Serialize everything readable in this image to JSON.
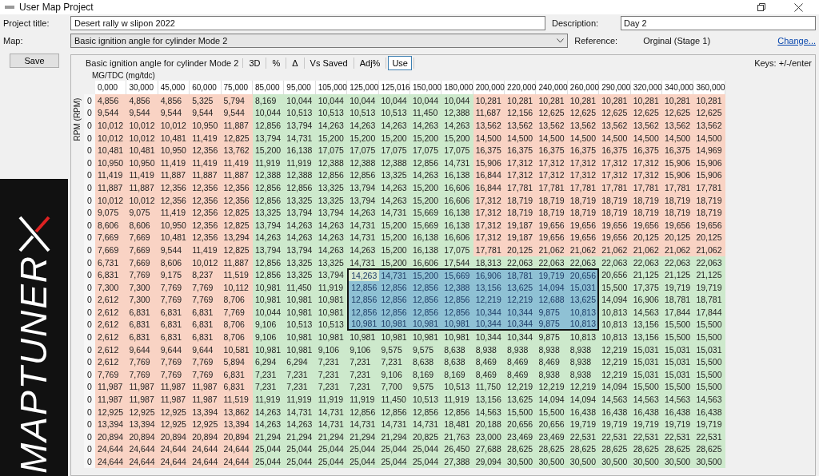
{
  "window": {
    "title": "User Map Project"
  },
  "form": {
    "project_title_label": "Project title:",
    "project_title": "Desert rally w slipon 2022",
    "map_label": "Map:",
    "map": "Basic ignition angle for cylinder Mode 2",
    "description_label": "Description:",
    "description": "Day 2",
    "reference_label": "Reference:",
    "reference": "Orginal (Stage 1)",
    "change_link": "Change..."
  },
  "save_button": "Save",
  "logo": {
    "text": "MAPTUNER"
  },
  "toolbar": {
    "title": "Basic ignition angle for cylinder Mode 2",
    "buttons": [
      {
        "label": "3D",
        "selected": false
      },
      {
        "label": "%",
        "selected": false
      },
      {
        "label": "Δ",
        "selected": false
      },
      {
        "label": "Vs Saved",
        "selected": false
      },
      {
        "label": "Adj%",
        "selected": false
      },
      {
        "label": "Use",
        "selected": true
      }
    ],
    "keys": "Keys: +/-/enter"
  },
  "table": {
    "x_axis_label": "MG/TDC (mg/tdc)",
    "y_axis_label": "RPM (RPM)",
    "columns": [
      {
        "label": "0,000",
        "color": "#f9d3c4",
        "green_below": false,
        "selected": false
      },
      {
        "label": "30,000",
        "color": "#f9d3c4",
        "green_below": false,
        "selected": false
      },
      {
        "label": "45,000",
        "color": "#f9d3c4",
        "green_below": false,
        "selected": false
      },
      {
        "label": "60,000",
        "color": "#f9d3c4",
        "green_below": false,
        "selected": false
      },
      {
        "label": "75,000",
        "color": "#f9d3c4",
        "green_below": false,
        "selected": false
      },
      {
        "label": "85,000",
        "color": "#cde9cc",
        "green_below": false,
        "selected": false
      },
      {
        "label": "95,000",
        "color": "#cde9cc",
        "green_below": false,
        "selected": false
      },
      {
        "label": "105,000",
        "color": "#cde9cc",
        "green_below": false,
        "selected": false
      },
      {
        "label": "125,000",
        "color": "#cde9cc",
        "green_below": false,
        "selected": true
      },
      {
        "label": "125,016",
        "color": "#cde9cc",
        "green_below": false,
        "selected": true
      },
      {
        "label": "150,000",
        "color": "#cde9cc",
        "green_below": false,
        "selected": true
      },
      {
        "label": "180,000",
        "color": "#cde9cc",
        "green_below": false,
        "selected": true
      },
      {
        "label": "200,000",
        "color": "#f9d3c4",
        "green_below": true,
        "selected": true
      },
      {
        "label": "220,000",
        "color": "#f9d3c4",
        "green_below": true,
        "selected": true
      },
      {
        "label": "240,000",
        "color": "#f9d3c4",
        "green_below": true,
        "selected": true
      },
      {
        "label": "260,000",
        "color": "#f9d3c4",
        "green_below": true,
        "selected": true
      },
      {
        "label": "290,000",
        "color": "#f9d3c4",
        "green_below": true,
        "selected": false
      },
      {
        "label": "320,000",
        "color": "#f9d3c4",
        "green_below": true,
        "selected": false
      },
      {
        "label": "340,000",
        "color": "#f9d3c4",
        "green_below": true,
        "selected": false
      },
      {
        "label": "360,000",
        "color": "#f9d3c4",
        "green_below": true,
        "selected": false
      }
    ],
    "rows": [
      {
        "label": "0",
        "lower": false,
        "selected": false,
        "cells": [
          "4,856",
          "4,856",
          "4,856",
          "5,325",
          "5,794",
          "8,169",
          "10,044",
          "10,044",
          "10,044",
          "10,044",
          "10,044",
          "10,044",
          "10,281",
          "10,281",
          "10,281",
          "10,281",
          "10,281",
          "10,281",
          "10,281",
          "10,281"
        ]
      },
      {
        "label": "0",
        "lower": false,
        "selected": false,
        "cells": [
          "9,544",
          "9,544",
          "9,544",
          "9,544",
          "9,544",
          "10,044",
          "10,513",
          "10,513",
          "10,513",
          "10,513",
          "11,450",
          "12,388",
          "11,687",
          "12,156",
          "12,625",
          "12,625",
          "12,625",
          "12,625",
          "12,625",
          "12,625"
        ]
      },
      {
        "label": "0",
        "lower": false,
        "selected": false,
        "cells": [
          "10,012",
          "10,012",
          "10,012",
          "10,950",
          "11,887",
          "12,856",
          "13,794",
          "14,263",
          "14,263",
          "14,263",
          "14,263",
          "14,263",
          "13,562",
          "13,562",
          "13,562",
          "13,562",
          "13,562",
          "13,562",
          "13,562",
          "13,562"
        ]
      },
      {
        "label": "0",
        "lower": false,
        "selected": false,
        "cells": [
          "10,012",
          "10,012",
          "10,481",
          "11,419",
          "12,825",
          "13,794",
          "14,731",
          "15,200",
          "15,200",
          "15,200",
          "15,200",
          "15,200",
          "14,500",
          "14,500",
          "14,500",
          "14,500",
          "14,500",
          "14,500",
          "14,500",
          "14,500"
        ]
      },
      {
        "label": "0",
        "lower": false,
        "selected": false,
        "cells": [
          "10,481",
          "10,481",
          "10,950",
          "12,356",
          "13,762",
          "15,200",
          "16,138",
          "17,075",
          "17,075",
          "17,075",
          "17,075",
          "17,075",
          "16,375",
          "16,375",
          "16,375",
          "16,375",
          "16,375",
          "16,375",
          "16,375",
          "14,969"
        ]
      },
      {
        "label": "0",
        "lower": false,
        "selected": false,
        "cells": [
          "10,950",
          "10,950",
          "11,419",
          "11,419",
          "11,419",
          "11,919",
          "11,919",
          "12,388",
          "12,388",
          "12,388",
          "12,856",
          "14,731",
          "15,906",
          "17,312",
          "17,312",
          "17,312",
          "17,312",
          "17,312",
          "15,906",
          "15,906"
        ]
      },
      {
        "label": "0",
        "lower": false,
        "selected": false,
        "cells": [
          "11,419",
          "11,419",
          "11,887",
          "11,887",
          "11,887",
          "12,388",
          "12,388",
          "12,856",
          "12,856",
          "13,325",
          "14,263",
          "16,138",
          "16,844",
          "17,312",
          "17,312",
          "17,312",
          "17,312",
          "17,312",
          "15,906",
          "15,906"
        ]
      },
      {
        "label": "0",
        "lower": false,
        "selected": false,
        "cells": [
          "11,887",
          "11,887",
          "12,356",
          "12,356",
          "12,356",
          "12,856",
          "12,856",
          "13,325",
          "13,794",
          "14,263",
          "15,200",
          "16,606",
          "16,844",
          "17,781",
          "17,781",
          "17,781",
          "17,781",
          "17,781",
          "17,781",
          "17,781"
        ]
      },
      {
        "label": "0",
        "lower": false,
        "selected": false,
        "cells": [
          "10,012",
          "10,012",
          "12,356",
          "12,356",
          "12,356",
          "12,856",
          "13,325",
          "13,325",
          "13,794",
          "14,263",
          "15,200",
          "16,606",
          "17,312",
          "18,719",
          "18,719",
          "18,719",
          "18,719",
          "18,719",
          "18,719",
          "18,719"
        ]
      },
      {
        "label": "0",
        "lower": false,
        "selected": false,
        "cells": [
          "9,075",
          "9,075",
          "11,419",
          "12,356",
          "12,825",
          "13,325",
          "13,794",
          "13,794",
          "14,263",
          "14,731",
          "15,669",
          "16,138",
          "17,312",
          "18,719",
          "18,719",
          "18,719",
          "18,719",
          "18,719",
          "18,719",
          "18,719"
        ]
      },
      {
        "label": "0",
        "lower": false,
        "selected": false,
        "cells": [
          "8,606",
          "8,606",
          "10,950",
          "12,356",
          "12,825",
          "13,794",
          "14,263",
          "14,263",
          "14,731",
          "15,200",
          "15,669",
          "16,138",
          "17,312",
          "19,187",
          "19,656",
          "19,656",
          "19,656",
          "19,656",
          "19,656",
          "19,656"
        ]
      },
      {
        "label": "0",
        "lower": false,
        "selected": false,
        "cells": [
          "7,669",
          "7,669",
          "10,481",
          "12,356",
          "13,294",
          "14,263",
          "14,263",
          "14,263",
          "14,731",
          "15,200",
          "16,138",
          "16,606",
          "17,312",
          "19,187",
          "19,656",
          "19,656",
          "19,656",
          "20,125",
          "20,125",
          "20,125"
        ]
      },
      {
        "label": "0",
        "lower": false,
        "selected": false,
        "cells": [
          "7,669",
          "7,669",
          "9,544",
          "11,419",
          "12,825",
          "13,794",
          "13,794",
          "14,263",
          "14,263",
          "15,200",
          "16,138",
          "17,075",
          "17,781",
          "20,125",
          "21,062",
          "21,062",
          "21,062",
          "21,062",
          "21,062",
          "21,062"
        ]
      },
      {
        "label": "0",
        "lower": true,
        "selected": false,
        "cells": [
          "6,731",
          "7,669",
          "8,606",
          "10,012",
          "11,887",
          "12,856",
          "13,325",
          "13,325",
          "14,731",
          "15,200",
          "16,606",
          "17,544",
          "18,313",
          "22,063",
          "22,063",
          "22,063",
          "22,063",
          "22,063",
          "22,063",
          "22,063"
        ]
      },
      {
        "label": "0",
        "lower": true,
        "selected": true,
        "cells": [
          "6,831",
          "7,769",
          "9,175",
          "8,237",
          "11,519",
          "12,856",
          "13,325",
          "13,794",
          "14,263",
          "14,731",
          "15,200",
          "15,669",
          "16,906",
          "18,781",
          "19,719",
          "20,656",
          "20,656",
          "21,125",
          "21,125",
          "21,125"
        ]
      },
      {
        "label": "0",
        "lower": true,
        "selected": true,
        "cells": [
          "7,300",
          "7,300",
          "7,769",
          "7,769",
          "10,112",
          "10,981",
          "11,450",
          "11,919",
          "12,856",
          "12,856",
          "12,856",
          "12,388",
          "13,156",
          "13,625",
          "14,094",
          "15,031",
          "15,500",
          "17,375",
          "19,719",
          "19,719"
        ]
      },
      {
        "label": "0",
        "lower": true,
        "selected": true,
        "cells": [
          "2,612",
          "7,300",
          "7,769",
          "7,769",
          "8,706",
          "10,981",
          "10,981",
          "10,981",
          "12,856",
          "12,856",
          "12,856",
          "12,856",
          "12,219",
          "12,219",
          "12,688",
          "13,625",
          "14,094",
          "16,906",
          "18,781",
          "18,781"
        ]
      },
      {
        "label": "0",
        "lower": true,
        "selected": true,
        "cells": [
          "2,612",
          "6,831",
          "6,831",
          "6,831",
          "7,769",
          "10,044",
          "10,981",
          "10,981",
          "12,856",
          "12,856",
          "12,856",
          "12,856",
          "10,344",
          "10,344",
          "9,875",
          "10,813",
          "10,813",
          "14,563",
          "17,844",
          "17,844"
        ]
      },
      {
        "label": "0",
        "lower": true,
        "selected": true,
        "cells": [
          "2,612",
          "6,831",
          "6,831",
          "6,831",
          "8,706",
          "9,106",
          "10,513",
          "10,513",
          "10,981",
          "10,981",
          "10,981",
          "10,981",
          "10,344",
          "10,344",
          "9,875",
          "10,813",
          "10,813",
          "13,156",
          "15,500",
          "15,500"
        ]
      },
      {
        "label": "0",
        "lower": true,
        "selected": false,
        "cells": [
          "2,612",
          "6,831",
          "6,831",
          "6,831",
          "8,706",
          "9,106",
          "10,981",
          "10,981",
          "10,981",
          "10,981",
          "10,981",
          "10,981",
          "10,344",
          "10,344",
          "9,875",
          "10,813",
          "10,813",
          "13,156",
          "15,500",
          "15,500"
        ]
      },
      {
        "label": "0",
        "lower": true,
        "selected": false,
        "cells": [
          "2,612",
          "9,644",
          "9,644",
          "9,644",
          "10,581",
          "10,981",
          "10,981",
          "9,106",
          "9,106",
          "9,575",
          "9,575",
          "8,638",
          "8,938",
          "8,938",
          "8,938",
          "8,938",
          "12,219",
          "15,031",
          "15,031",
          "15,031"
        ]
      },
      {
        "label": "0",
        "lower": true,
        "selected": false,
        "cells": [
          "2,612",
          "7,769",
          "7,769",
          "7,769",
          "5,894",
          "6,294",
          "6,294",
          "7,231",
          "7,231",
          "7,231",
          "8,638",
          "8,638",
          "8,469",
          "8,469",
          "8,469",
          "8,938",
          "12,219",
          "15,031",
          "15,031",
          "15,500"
        ]
      },
      {
        "label": "0",
        "lower": true,
        "selected": false,
        "cells": [
          "7,769",
          "7,769",
          "7,769",
          "7,769",
          "6,831",
          "7,231",
          "7,231",
          "7,231",
          "7,231",
          "9,106",
          "8,169",
          "8,169",
          "8,469",
          "8,469",
          "8,938",
          "8,938",
          "12,219",
          "15,031",
          "15,031",
          "15,500"
        ]
      },
      {
        "label": "0",
        "lower": true,
        "selected": false,
        "cells": [
          "11,987",
          "11,987",
          "11,987",
          "11,987",
          "6,831",
          "7,231",
          "7,231",
          "7,231",
          "7,231",
          "7,700",
          "9,575",
          "10,513",
          "11,750",
          "12,219",
          "12,219",
          "12,219",
          "14,094",
          "15,500",
          "15,500",
          "15,500"
        ]
      },
      {
        "label": "0",
        "lower": true,
        "selected": false,
        "cells": [
          "11,987",
          "11,987",
          "11,987",
          "11,987",
          "11,519",
          "11,919",
          "11,919",
          "11,919",
          "11,919",
          "11,450",
          "10,513",
          "11,919",
          "13,156",
          "13,625",
          "14,094",
          "14,094",
          "14,563",
          "14,563",
          "14,563",
          "14,563"
        ]
      },
      {
        "label": "0",
        "lower": true,
        "selected": false,
        "cells": [
          "12,925",
          "12,925",
          "12,925",
          "13,394",
          "13,862",
          "14,263",
          "14,731",
          "14,731",
          "12,856",
          "12,856",
          "12,856",
          "12,856",
          "14,563",
          "15,500",
          "15,500",
          "16,438",
          "16,438",
          "16,438",
          "16,438",
          "16,438"
        ]
      },
      {
        "label": "0",
        "lower": true,
        "selected": false,
        "cells": [
          "13,394",
          "13,394",
          "12,925",
          "12,925",
          "13,394",
          "14,263",
          "14,263",
          "14,731",
          "14,731",
          "14,731",
          "14,731",
          "18,481",
          "20,188",
          "20,656",
          "20,656",
          "19,719",
          "19,719",
          "19,719",
          "19,719",
          "19,719"
        ]
      },
      {
        "label": "0",
        "lower": true,
        "selected": false,
        "cells": [
          "20,894",
          "20,894",
          "20,894",
          "20,894",
          "20,894",
          "21,294",
          "21,294",
          "21,294",
          "21,294",
          "21,294",
          "20,825",
          "21,763",
          "23,000",
          "23,469",
          "23,469",
          "22,531",
          "22,531",
          "22,531",
          "22,531",
          "22,531"
        ]
      },
      {
        "label": "0",
        "lower": true,
        "selected": false,
        "cells": [
          "24,644",
          "24,644",
          "24,644",
          "24,644",
          "24,644",
          "25,044",
          "25,044",
          "25,044",
          "25,044",
          "25,044",
          "25,044",
          "26,450",
          "27,688",
          "28,625",
          "28,625",
          "28,625",
          "28,625",
          "28,625",
          "28,625",
          "28,625"
        ]
      },
      {
        "label": "0",
        "lower": true,
        "selected": false,
        "cells": [
          "24,644",
          "24,644",
          "24,644",
          "24,644",
          "24,644",
          "25,044",
          "25,044",
          "25,044",
          "25,044",
          "25,044",
          "25,044",
          "27,388",
          "29,094",
          "30,500",
          "30,500",
          "30,500",
          "30,500",
          "30,500",
          "30,500",
          "30,500"
        ]
      }
    ]
  }
}
